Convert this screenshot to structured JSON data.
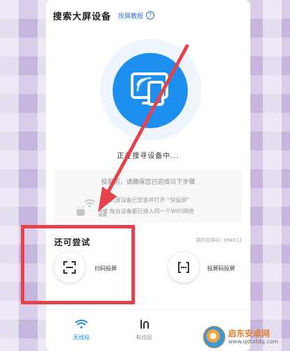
{
  "header": {
    "title": "搜索大屏设备",
    "tutorial_link": "投屏教程",
    "help_glyph": "?"
  },
  "search": {
    "status": "正在搜寻设备中..."
  },
  "hint": {
    "title": "投屏前，请确保您已完成以下步骤",
    "step1": "1.大屏设备已安装并打开 “快投屏”",
    "step2": "2.每台设备都已接入同一个WIFI网络"
  },
  "try_section": {
    "title": "还可尝试",
    "cast_code": "我的投屏码: 968813",
    "scan_label": "扫码投屏",
    "code_label": "投屏码投屏"
  },
  "bottom_nav": {
    "wireless_label": "无线投",
    "wired_label": "有线投"
  },
  "watermark": {
    "name": "启东安卓网",
    "url": "www.qdtxtdq.com"
  },
  "colors": {
    "accent": "#1c8ff0",
    "annotation": "#e7424b"
  }
}
